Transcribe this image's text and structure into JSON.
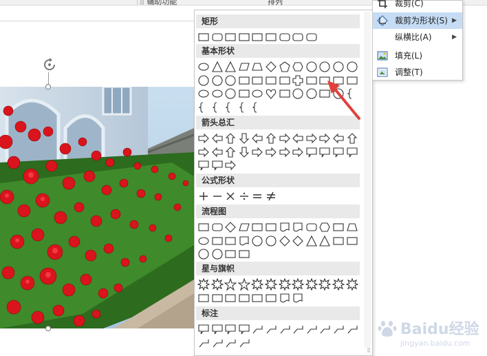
{
  "ribbon": {
    "group_label_1": "辅助功能",
    "group_label_2": "排列"
  },
  "context_menu": {
    "items": [
      {
        "label": "裁剪(C)",
        "icon": "crop-icon",
        "has_submenu": false
      },
      {
        "label": "裁剪为形状(S)",
        "icon": "crop-to-shape-icon",
        "has_submenu": true,
        "highlighted": true
      },
      {
        "label": "纵横比(A)",
        "icon": "",
        "has_submenu": true
      },
      {
        "label": "填充(L)",
        "icon": "fill-picture-icon",
        "has_submenu": false
      },
      {
        "label": "调整(T)",
        "icon": "fit-picture-icon",
        "has_submenu": false
      }
    ]
  },
  "shapes_gallery": {
    "sections": [
      {
        "title": "矩形",
        "shapes": [
          "rectangle",
          "rounded-rectangle",
          "snip-single-corner-rectangle",
          "snip-same-side-rectangle",
          "snip-diagonal-rectangle",
          "snip-round-rectangle",
          "round-single-corner-rectangle",
          "round-same-side-rectangle",
          "round-diagonal-rectangle"
        ]
      },
      {
        "title": "基本形状",
        "shapes": [
          "oval",
          "isosceles-triangle",
          "right-triangle",
          "parallelogram",
          "trapezoid",
          "diamond",
          "pentagon",
          "hexagon",
          "heptagon",
          "octagon",
          "decagon",
          "dodecagon",
          "pie",
          "chord",
          "teardrop",
          "frame",
          "half-frame",
          "l-shape",
          "diagonal-stripe",
          "cross",
          "plaque",
          "can",
          "cube",
          "bevel",
          "donut",
          "no-symbol",
          "block-arc",
          "folded-corner",
          "smiley-face",
          "heart",
          "lightning-bolt",
          "sun",
          "moon",
          "cloud",
          "arc",
          "double-bracket",
          "double-brace",
          "left-bracket",
          "right-bracket",
          "left-brace",
          "right-brace"
        ]
      },
      {
        "title": "箭头总汇",
        "shapes": [
          "right-arrow",
          "left-arrow",
          "up-arrow",
          "down-arrow",
          "left-right-arrow",
          "up-down-arrow",
          "quad-arrow",
          "left-right-up-arrow",
          "bent-arrow",
          "u-turn-arrow",
          "left-up-arrow",
          "bent-up-arrow",
          "curved-right-arrow",
          "curved-left-arrow",
          "curved-up-arrow",
          "curved-down-arrow",
          "striped-right-arrow",
          "notched-right-arrow",
          "pentagon-arrow",
          "chevron",
          "right-arrow-callout",
          "down-arrow-callout",
          "left-arrow-callout",
          "up-arrow-callout",
          "left-right-arrow-callout",
          "quad-arrow-callout",
          "circular-arrow"
        ]
      },
      {
        "title": "公式形状",
        "shapes": [
          "plus",
          "minus",
          "multiply",
          "divide",
          "equal",
          "not-equal"
        ]
      },
      {
        "title": "流程图",
        "shapes": [
          "process",
          "alternate-process",
          "decision",
          "data",
          "predefined-process",
          "internal-storage",
          "document",
          "multidocument",
          "terminator",
          "preparation",
          "manual-input",
          "manual-operation",
          "connector",
          "off-page-connector",
          "card",
          "punched-tape",
          "summing-junction",
          "or",
          "collate",
          "sort",
          "extract",
          "merge",
          "stored-data",
          "delay",
          "sequential-access-storage",
          "magnetic-disk",
          "direct-access-storage",
          "display"
        ]
      },
      {
        "title": "星与旗帜",
        "shapes": [
          "explosion-1",
          "explosion-2",
          "star-4",
          "star-5",
          "star-6",
          "star-7",
          "star-8",
          "star-10",
          "star-12",
          "star-16",
          "star-24",
          "star-32",
          "up-ribbon",
          "down-ribbon",
          "curved-up-ribbon",
          "curved-down-ribbon",
          "vertical-scroll",
          "horizontal-scroll",
          "wave",
          "double-wave"
        ]
      },
      {
        "title": "标注",
        "shapes": [
          "rectangular-callout",
          "rounded-rectangular-callout",
          "oval-callout",
          "cloud-callout",
          "line-callout-1",
          "line-callout-2",
          "line-callout-3",
          "line-callout-4",
          "line-callout-1-accent-bar",
          "line-callout-2-accent-bar",
          "line-callout-3-accent-bar",
          "line-callout-4-accent-bar",
          "line-callout-1-no-border",
          "line-callout-2-no-border",
          "line-callout-3-no-border",
          "line-callout-4-no-border"
        ]
      }
    ]
  },
  "watermark": {
    "brand": "Baidu经验",
    "url": "jingyan.baidu.com"
  },
  "colors": {
    "menu_highlight": "#c5dcf4",
    "section_header": "#e9e9e9",
    "annotation_arrow": "#e0403c",
    "rose_red": "#d9141c"
  }
}
